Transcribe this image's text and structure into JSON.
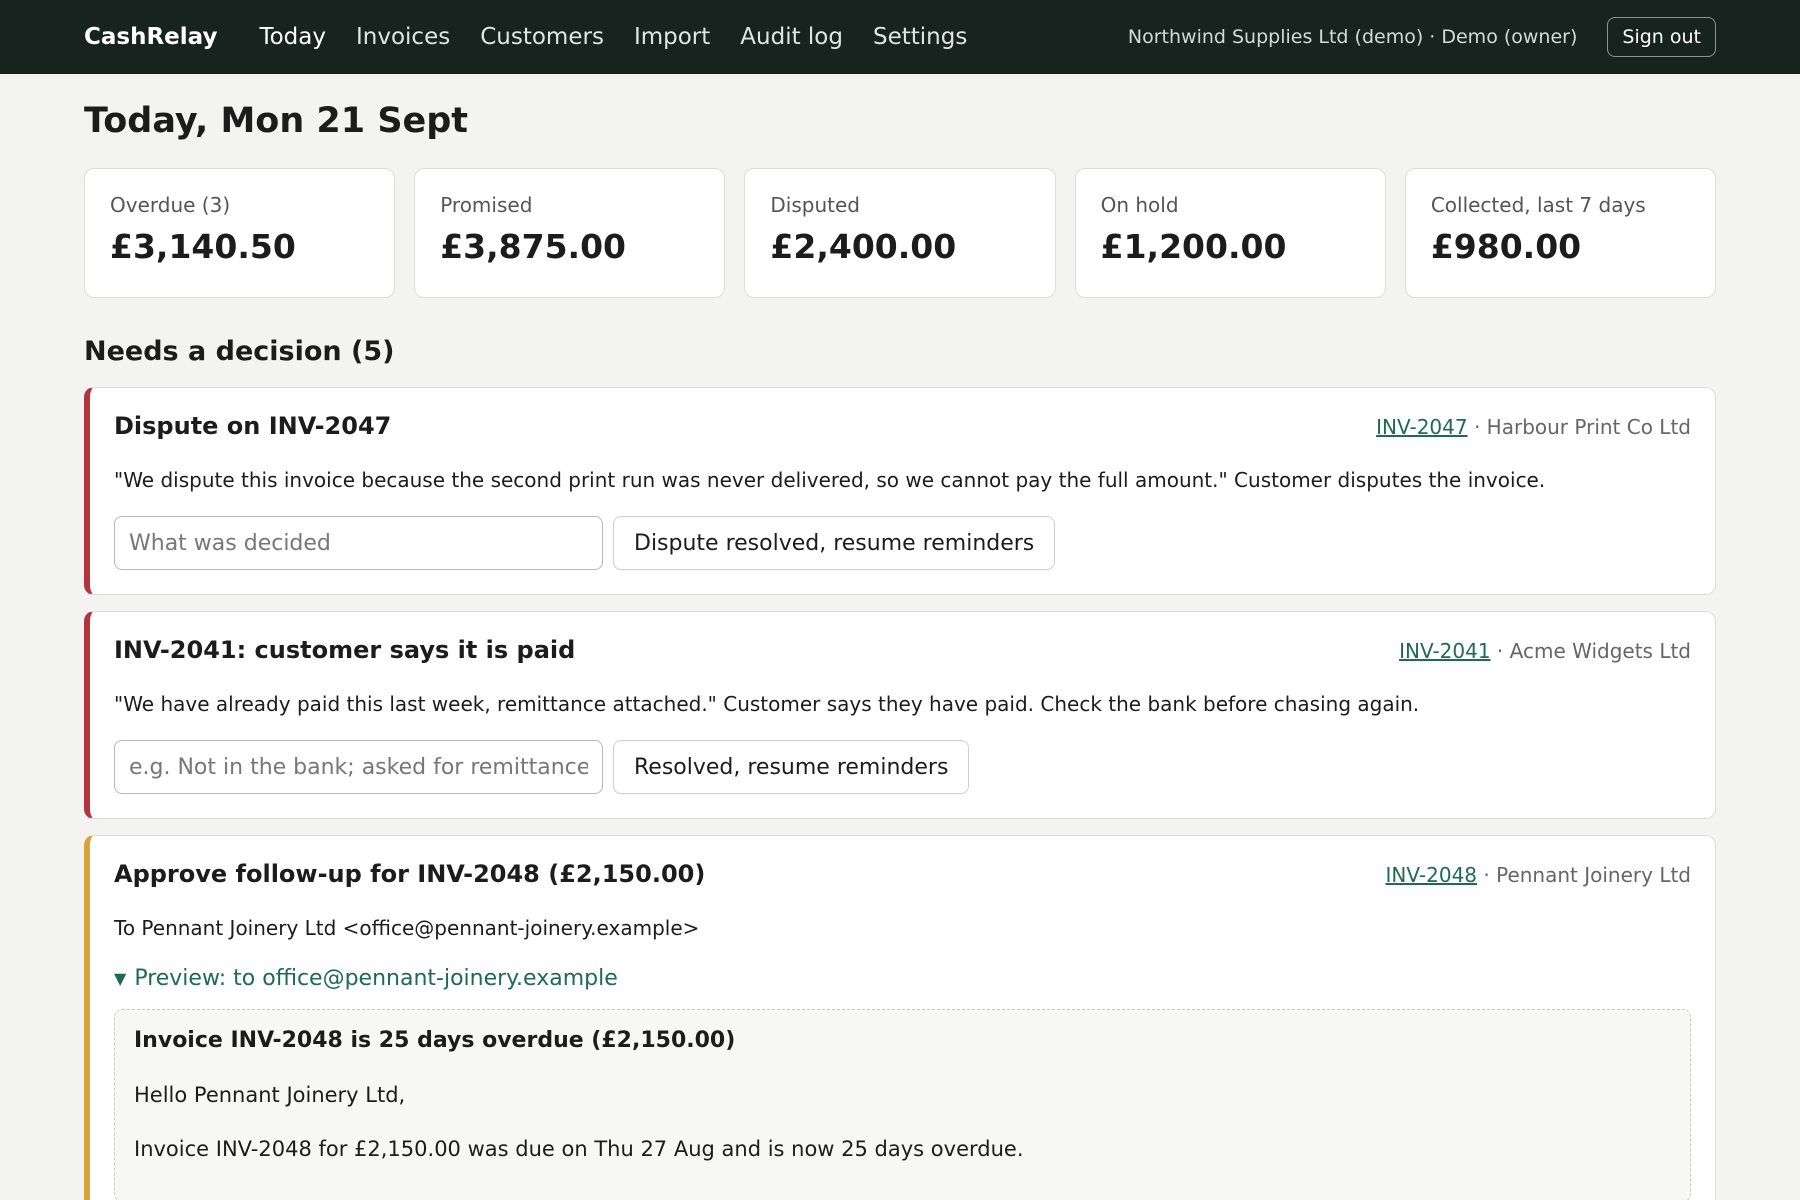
{
  "nav": {
    "brand": "CashRelay",
    "items": [
      "Today",
      "Invoices",
      "Customers",
      "Import",
      "Audit log",
      "Settings"
    ],
    "account": "Northwind Supplies Ltd (demo) · Demo (owner)",
    "sign_out": "Sign out"
  },
  "page": {
    "title": "Today, Mon 21 Sept"
  },
  "stats": [
    {
      "label": "Overdue (3)",
      "value": "£3,140.50"
    },
    {
      "label": "Promised",
      "value": "£3,875.00"
    },
    {
      "label": "Disputed",
      "value": "£2,400.00"
    },
    {
      "label": "On hold",
      "value": "£1,200.00"
    },
    {
      "label": "Collected, last 7 days",
      "value": "£980.00"
    }
  ],
  "decisions": {
    "heading": "Needs a decision (5)",
    "items": [
      {
        "title": "Dispute on INV-2047",
        "invoice": "INV-2047",
        "customer": "· Harbour Print Co Ltd",
        "body": "\"We dispute this invoice because the second print run was never delivered, so we cannot pay the full amount.\" Customer disputes the invoice.",
        "input_placeholder": "What was decided",
        "action": "Dispute resolved, resume reminders"
      },
      {
        "title": "INV-2041: customer says it is paid",
        "invoice": "INV-2041",
        "customer": "· Acme Widgets Ltd",
        "body": "\"We have already paid this last week, remittance attached.\" Customer says they have paid. Check the bank before chasing again.",
        "input_placeholder": "e.g. Not in the bank; asked for remittance",
        "action": "Resolved, resume reminders"
      },
      {
        "title": "Approve follow-up for INV-2048 (£2,150.00)",
        "invoice": "INV-2048",
        "customer": "· Pennant Joinery Ltd",
        "to_line": "To Pennant Joinery Ltd <office@pennant-joinery.example>",
        "preview_toggle": "Preview: to office@pennant-joinery.example",
        "preview_subject": "Invoice INV-2048 is 25 days overdue (£2,150.00)",
        "preview_greeting": "Hello Pennant Joinery Ltd,",
        "preview_line": "Invoice INV-2048 for £2,150.00 was due on Thu 27 Aug and is now 25 days overdue."
      }
    ]
  },
  "colors": {
    "nav_bg": "#16231f",
    "danger": "#b3343a",
    "warning": "#d9a23a",
    "link": "#1f6b52"
  }
}
